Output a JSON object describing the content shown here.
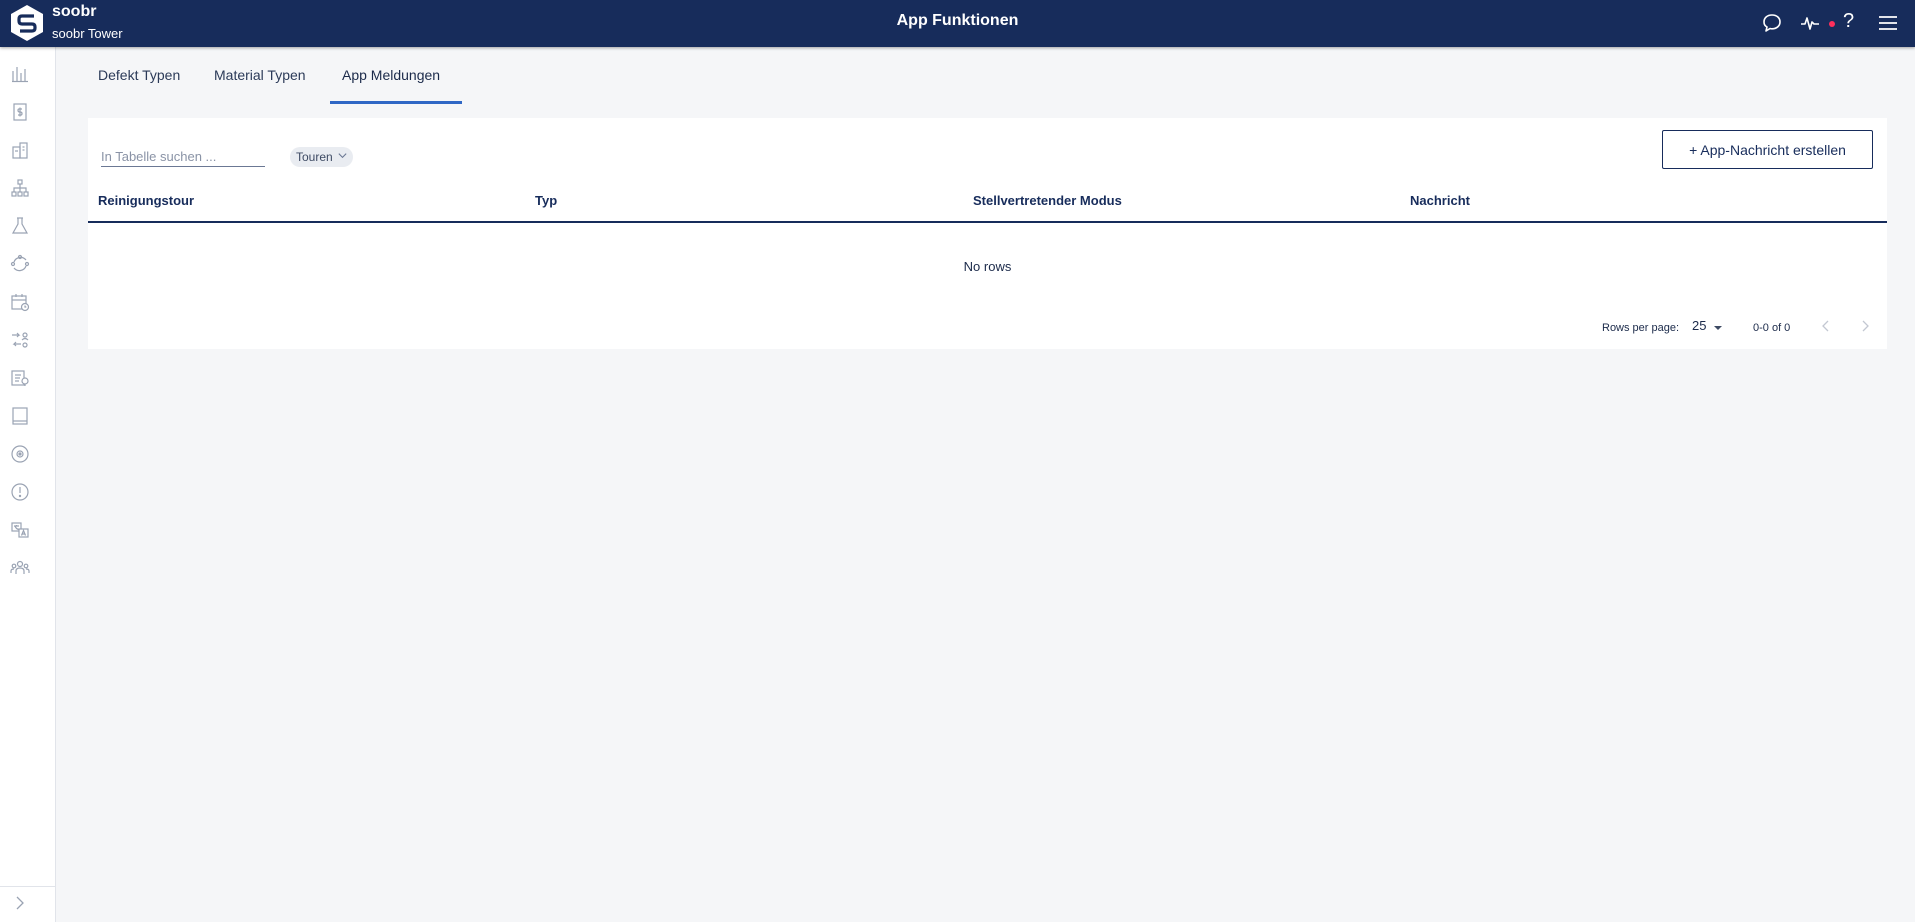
{
  "header": {
    "brand": "soobr",
    "subtitle": "soobr Tower",
    "title": "App Funktionen"
  },
  "tabs": [
    {
      "label": "Defekt Typen",
      "active": false
    },
    {
      "label": "Material Typen",
      "active": false
    },
    {
      "label": "App Meldungen",
      "active": true
    }
  ],
  "toolbar": {
    "search_placeholder": "In Tabelle suchen ...",
    "filter_chip": "Touren",
    "create_button": "+ App-Nachricht erstellen"
  },
  "table": {
    "columns": [
      "Reinigungstour",
      "Typ",
      "Stellvertretender Modus",
      "Nachricht"
    ],
    "rows": [],
    "empty_text": "No rows"
  },
  "pagination": {
    "rows_per_page_label": "Rows per page:",
    "rows_per_page": "25",
    "range": "0-0 of 0"
  },
  "colors": {
    "header_bg": "#172c5b",
    "accent": "#2f67c5",
    "notification_dot": "#ff2f5c"
  },
  "sidebar_icons": [
    "analytics-icon",
    "invoice-icon",
    "building-icon",
    "hierarchy-icon",
    "flask-icon",
    "cycle-icon",
    "calendar-clock-icon",
    "shuffle-people-icon",
    "task-list-icon",
    "tablet-icon",
    "target-icon",
    "alert-icon",
    "translate-icon",
    "team-icon"
  ]
}
